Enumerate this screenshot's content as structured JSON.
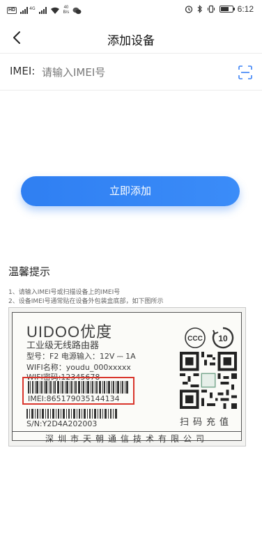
{
  "statusbar": {
    "signal_label": "4G",
    "net_speed_value": "40",
    "net_speed_unit": "B/s",
    "time": "6:12"
  },
  "nav": {
    "title": "添加设备"
  },
  "imei": {
    "label": "IMEI:",
    "placeholder": "请输入IMEI号"
  },
  "add_button_label": "立即添加",
  "tips": {
    "title": "温馨提示",
    "line1": "1、请输入IMEI号或扫描设备上的IMEI号",
    "line2": "2、设备IMEI号通常贴在设备外包装盒底部，如下图所示"
  },
  "device_label": {
    "brand": "UIDOO优度",
    "product": "工业级无线路由器",
    "model_line": "型号：F2     电源输入：12V ⎓ 1A",
    "wifi_name": "WIFI名称：youdu_000xxxxx",
    "wifi_password": "WIFI密码:12345678",
    "imei": "IMEI:865179035144134",
    "serial": "S/N:Y2D4A202003",
    "cert_ccc": "CCC",
    "cert_years": "10",
    "scan_text": "扫码充值",
    "company": "深圳市天朝通信技术有限公司",
    "highlight_color": "#d9352c"
  },
  "colors": {
    "accent": "#2f7ff2",
    "scan_icon": "#3b82f6"
  },
  "icons": {
    "back": "chevron-left-icon",
    "scan": "scan-frame-icon"
  }
}
